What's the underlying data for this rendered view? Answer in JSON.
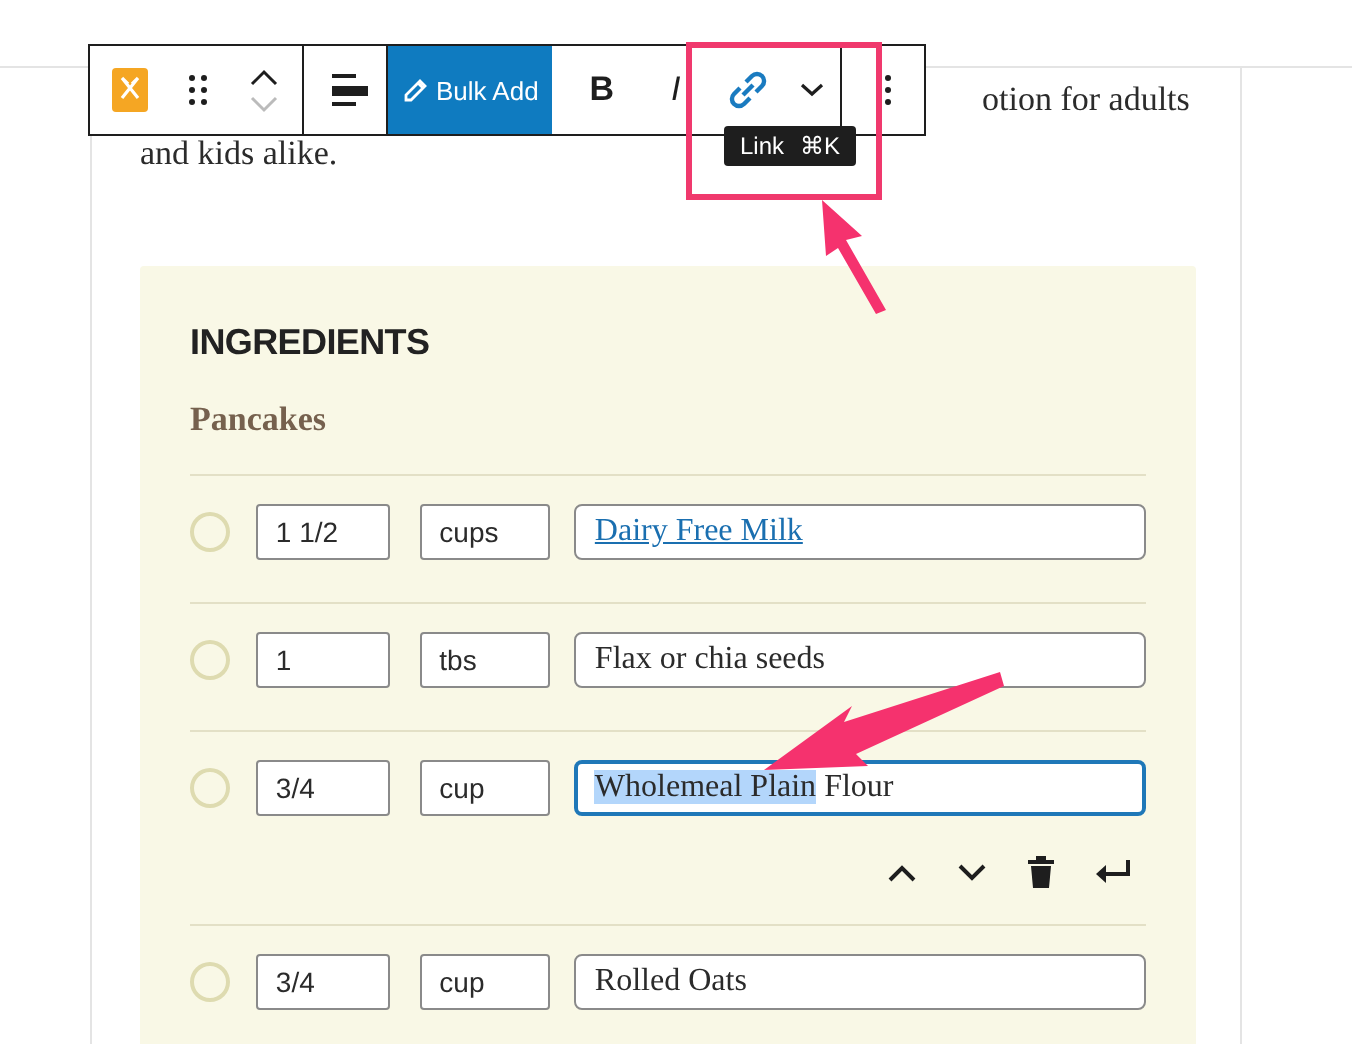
{
  "paragraph": {
    "lines": [
      "otion for adults",
      "and kids alike."
    ]
  },
  "toolbar": {
    "items": [
      {
        "kind": "block-icon"
      },
      {
        "kind": "drag"
      },
      {
        "kind": "mover"
      },
      {
        "kind": "separator"
      },
      {
        "kind": "align"
      },
      {
        "kind": "separator"
      },
      {
        "kind": "primary",
        "label": "Bulk Add"
      },
      {
        "kind": "bold",
        "label": "B",
        "highlighted": false
      },
      {
        "kind": "italic",
        "label": "I",
        "highlighted": false
      },
      {
        "kind": "link",
        "highlighted": true
      },
      {
        "kind": "more"
      },
      {
        "kind": "separator"
      },
      {
        "kind": "options"
      }
    ],
    "tooltip": {
      "label": "Link",
      "shortcut": "⌘K"
    }
  },
  "ingredients": {
    "title": "INGREDIENTS",
    "group": "Pancakes",
    "rows": [
      {
        "checked": false,
        "amount": "1 1/2",
        "unit": "cups",
        "linked": true,
        "focused": false,
        "name": [
          {
            "text": "Dairy Free Milk",
            "selected": false
          }
        ]
      },
      {
        "checked": false,
        "amount": "1",
        "unit": "tbs",
        "linked": false,
        "focused": false,
        "name": [
          {
            "text": "Flax or chia seeds",
            "selected": false
          }
        ]
      },
      {
        "checked": false,
        "amount": "3/4",
        "unit": "cup",
        "linked": false,
        "focused": true,
        "name": [
          {
            "text": "Wholemeal Plain",
            "selected": true
          },
          {
            "text": " Flour",
            "selected": false
          }
        ]
      },
      {
        "checked": false,
        "amount": "3/4",
        "unit": "cup",
        "linked": false,
        "focused": false,
        "name": [
          {
            "text": "Rolled Oats",
            "selected": false
          }
        ]
      }
    ]
  }
}
